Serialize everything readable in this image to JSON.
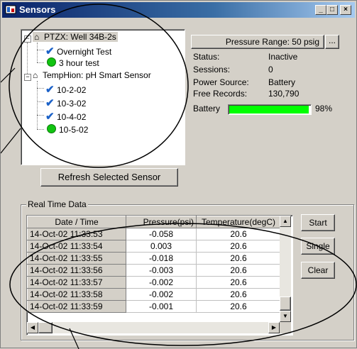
{
  "window": {
    "title": "Sensors"
  },
  "tree": {
    "sensors": [
      {
        "label": "PTZX: Well 34B-2s",
        "tests": [
          {
            "label": "Overnight Test",
            "status": "complete"
          },
          {
            "label": "3 hour test",
            "status": "active"
          }
        ]
      },
      {
        "label": "TempHion: pH Smart Sensor",
        "tests": [
          {
            "label": "10-2-02",
            "status": "complete"
          },
          {
            "label": "10-3-02",
            "status": "complete"
          },
          {
            "label": "10-4-02",
            "status": "complete"
          },
          {
            "label": "10-5-02",
            "status": "active"
          }
        ]
      }
    ]
  },
  "details": {
    "pressure_range": "Pressure Range: 50 psig",
    "browse_label": "...",
    "status_label": "Status:",
    "status_value": "Inactive",
    "sessions_label": "Sessions:",
    "sessions_value": "0",
    "power_label": "Power Source:",
    "power_value": "Battery",
    "free_label": "Free Records:",
    "free_value": "130,790",
    "battery_label": "Battery",
    "battery_percent": 98,
    "battery_text": "98%",
    "battery_color": "#00ff00"
  },
  "refresh_button": "Refresh Selected Sensor",
  "realtime": {
    "group_label": "Real Time Data",
    "columns": [
      "Date / Time",
      "Pressure(psi)",
      "Temperature(degC)"
    ],
    "rows": [
      [
        "14-Oct-02  11:33:53",
        "-0.058",
        "20.6"
      ],
      [
        "14-Oct-02  11:33:54",
        "0.003",
        "20.6"
      ],
      [
        "14-Oct-02  11:33:55",
        "-0.018",
        "20.6"
      ],
      [
        "14-Oct-02  11:33:56",
        "-0.003",
        "20.6"
      ],
      [
        "14-Oct-02  11:33:57",
        "-0.002",
        "20.6"
      ],
      [
        "14-Oct-02  11:33:58",
        "-0.002",
        "20.6"
      ],
      [
        "14-Oct-02  11:33:59",
        "-0.001",
        "20.6"
      ]
    ],
    "buttons": {
      "start": "Start",
      "single": "Single",
      "clear": "Clear"
    }
  }
}
